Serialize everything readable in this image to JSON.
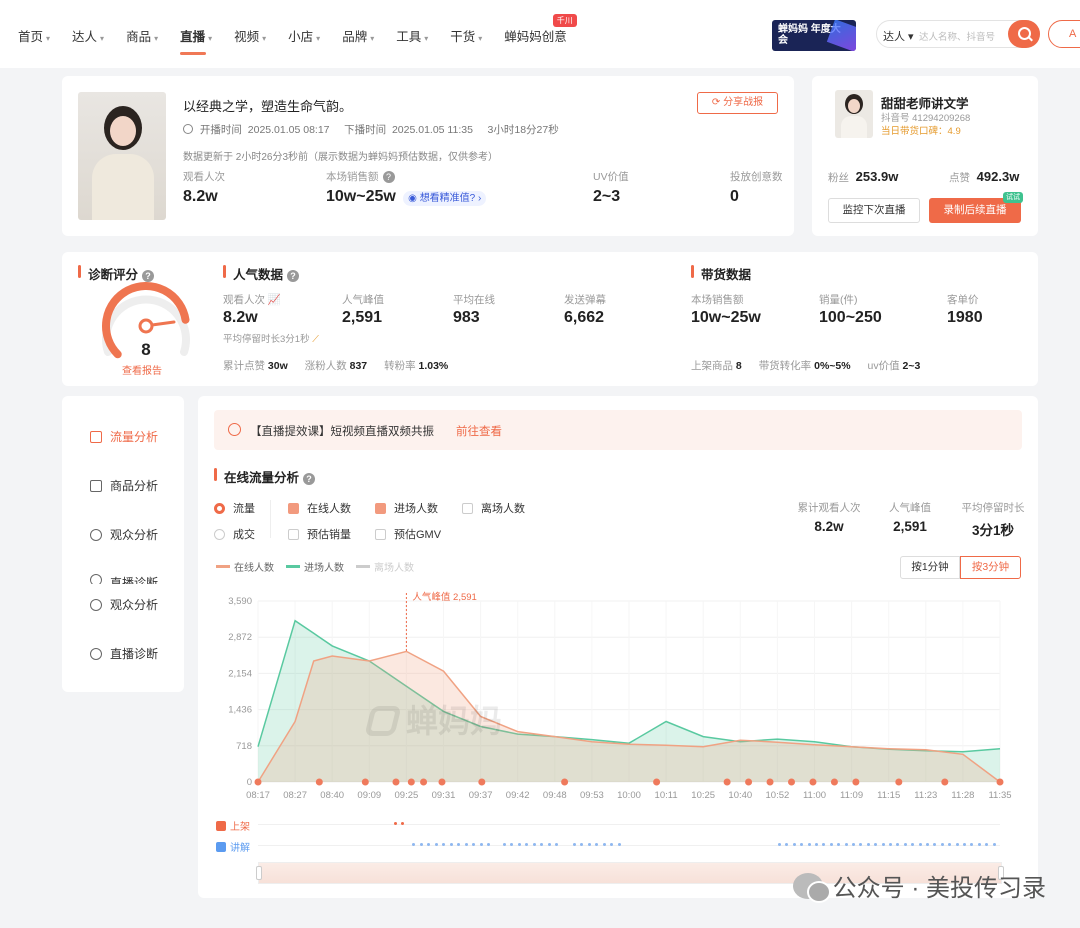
{
  "nav": {
    "items": [
      {
        "label": "首页",
        "caret": true
      },
      {
        "label": "达人",
        "caret": true
      },
      {
        "label": "商品",
        "caret": true
      },
      {
        "label": "直播",
        "caret": true,
        "active": true
      },
      {
        "label": "视频",
        "caret": true
      },
      {
        "label": "小店",
        "caret": true
      },
      {
        "label": "品牌",
        "caret": true
      },
      {
        "label": "工具",
        "caret": true
      },
      {
        "label": "干货",
        "caret": true
      },
      {
        "label": "蝉妈妈创意",
        "caret": false,
        "badge": "千川"
      }
    ],
    "banner": "蝉妈妈 年度大会",
    "search_select": "达人",
    "search_placeholder": "达人名称、抖音号",
    "login": "A"
  },
  "live": {
    "title": "以经典之学，塑造生命气韵。",
    "start_label": "开播时间",
    "start_time": "2025.01.05 08:17",
    "end_label": "下播时间",
    "end_time": "2025.01.05 11:35",
    "duration": "3小时18分27秒",
    "update_note": "数据更新于 2小时26分3秒前（展示数据为蝉妈妈预估数据，仅供参考）",
    "share_btn": "分享战报",
    "metrics": [
      {
        "label": "观看人次",
        "value": "8.2w"
      },
      {
        "label": "本场销售额",
        "value": "10w~25w",
        "extra": "想看精准值?"
      },
      {
        "label": "UV价值",
        "value": "2~3"
      },
      {
        "label": "投放创意数",
        "value": "0"
      }
    ]
  },
  "anchor": {
    "name": "甜甜老师讲文学",
    "douyin_id": "抖音号 41294209268",
    "reputation_label": "当日带货口碑：",
    "reputation": "4.9",
    "fans_label": "粉丝",
    "fans": "253.9w",
    "likes_label": "点赞",
    "likes": "492.3w",
    "monitor_btn": "监控下次直播",
    "record_btn": "录制后续直播",
    "record_badge": "试试"
  },
  "diagnosis": {
    "title": "诊断评分",
    "score": "8",
    "score_value": 8,
    "report_link": "查看报告"
  },
  "popularity": {
    "title": "人气数据",
    "metrics": [
      {
        "label": "观看人次",
        "value": "8.2w"
      },
      {
        "label": "人气峰值",
        "value": "2,591"
      },
      {
        "label": "平均在线",
        "value": "983"
      },
      {
        "label": "发送弹幕",
        "value": "6,662"
      }
    ],
    "stay": "平均停留时长3分1秒",
    "bottom": [
      {
        "label": "累计点赞",
        "value": "30w"
      },
      {
        "label": "涨粉人数",
        "value": "837"
      },
      {
        "label": "转粉率",
        "value": "1.03%"
      }
    ]
  },
  "goods": {
    "title": "带货数据",
    "metrics": [
      {
        "label": "本场销售额",
        "value": "10w~25w"
      },
      {
        "label": "销量(件)",
        "value": "100~250"
      },
      {
        "label": "客单价",
        "value": "1980"
      }
    ],
    "bottom": [
      {
        "label": "上架商品",
        "value": "8"
      },
      {
        "label": "带货转化率",
        "value": "0%~5%"
      },
      {
        "label": "uv价值",
        "value": "2~3"
      }
    ]
  },
  "sidebar": {
    "items": [
      {
        "label": "流量分析",
        "active": true
      },
      {
        "label": "商品分析"
      },
      {
        "label": "观众分析"
      },
      {
        "label": "直播诊断"
      },
      {
        "label": "观众分析"
      },
      {
        "label": "直播诊断"
      }
    ]
  },
  "promo": {
    "text": "【直播提效课】短视频直播双频共振",
    "link": "前往查看"
  },
  "traffic": {
    "title": "在线流量分析",
    "radio": [
      {
        "label": "流量",
        "on": true
      },
      {
        "label": "成交",
        "on": false
      }
    ],
    "checks_row1": [
      {
        "label": "在线人数",
        "on": true
      },
      {
        "label": "进场人数",
        "on": true
      },
      {
        "label": "离场人数",
        "on": false
      }
    ],
    "checks_row2": [
      {
        "label": "预估销量",
        "on": false
      },
      {
        "label": "预估GMV",
        "on": false
      }
    ],
    "stats": [
      {
        "label": "累计观看人次",
        "value": "8.2w"
      },
      {
        "label": "人气峰值",
        "value": "2,591"
      },
      {
        "label": "平均停留时长",
        "value": "3分1秒"
      }
    ],
    "legend": [
      {
        "label": "在线人数",
        "color": "#f0a283"
      },
      {
        "label": "进场人数",
        "color": "#59c9a0"
      },
      {
        "label": "离场人数",
        "color": "#cccccc"
      }
    ],
    "btn_1min": "按1分钟",
    "btn_3min": "按3分钟",
    "peak_label": "人气峰值 2,591",
    "row_shelf": "上架",
    "row_explain": "讲解",
    "watermark": "蝉妈妈"
  },
  "chart_data": {
    "type": "area",
    "title": "",
    "xlabel": "",
    "ylabel": "",
    "ylim": [
      0,
      3590
    ],
    "yticks": [
      "0",
      "718",
      "1,436",
      "2,154",
      "2,872",
      "3,590"
    ],
    "x_ticks": [
      "08:17",
      "08:27",
      "08:40",
      "09:09",
      "09:25",
      "09:31",
      "09:37",
      "09:42",
      "09:48",
      "09:53",
      "10:00",
      "10:11",
      "10:25",
      "10:40",
      "10:52",
      "11:00",
      "11:09",
      "11:15",
      "11:23",
      "11:28",
      "11:35"
    ],
    "x": [
      0,
      1,
      1.5,
      2,
      3,
      4,
      5,
      6,
      7,
      8,
      9,
      10,
      11,
      12,
      13,
      14,
      15,
      16,
      17,
      18,
      19,
      20
    ],
    "series": [
      {
        "name": "在线人数",
        "color": "#f0a283",
        "values": [
          0,
          1200,
          2400,
          2500,
          2400,
          2591,
          2200,
          1300,
          1000,
          900,
          800,
          750,
          730,
          700,
          830,
          790,
          740,
          700,
          660,
          640,
          550,
          0
        ]
      },
      {
        "name": "进场人数",
        "color": "#59c9a0",
        "values": [
          700,
          3200,
          2950,
          2700,
          2400,
          1900,
          1400,
          1100,
          950,
          900,
          840,
          770,
          1200,
          900,
          800,
          850,
          800,
          700,
          650,
          620,
          600,
          660
        ]
      }
    ],
    "grid": true,
    "legend": "top-left"
  },
  "footer_watermark": "公众号 · 美投传习录"
}
